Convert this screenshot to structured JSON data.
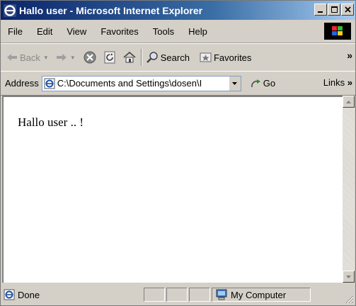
{
  "window": {
    "title": "Hallo user - Microsoft Internet Explorer"
  },
  "menu": [
    "File",
    "Edit",
    "View",
    "Favorites",
    "Tools",
    "Help"
  ],
  "toolbar": {
    "back": "Back",
    "search": "Search",
    "favorites": "Favorites",
    "more": "»"
  },
  "address": {
    "label": "Address",
    "value": "C:\\Documents and Settings\\dosen\\I",
    "go": "Go",
    "links": "Links",
    "links_more": "»"
  },
  "page": {
    "text": "Hallo user .. !"
  },
  "status": {
    "text": "Done",
    "zone": "My Computer"
  },
  "colors": {
    "titlebar_start": "#0a246a",
    "titlebar_end": "#a6caf0",
    "chrome": "#d4d0c8"
  }
}
